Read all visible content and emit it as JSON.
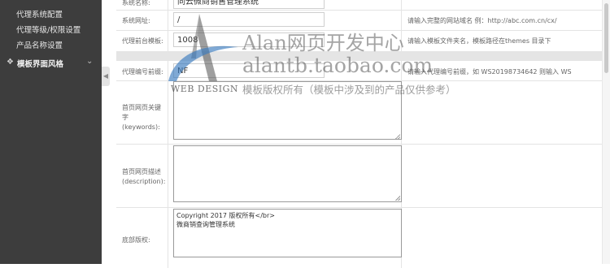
{
  "sidebar": {
    "items": [
      {
        "label": "代理系统配置"
      },
      {
        "label": "代理等级/权限设置"
      },
      {
        "label": "产品名称设置"
      }
    ],
    "section": {
      "label": "模板界面风格",
      "icon": "settings-gear-icon"
    }
  },
  "form": {
    "rows": [
      {
        "label": "系统名称:",
        "value": "同云微商销售管理系统",
        "hint": ""
      },
      {
        "label": "系统网址:",
        "value": "/",
        "hint": "请输入完整的网站域名 例：http://abc.com.cn/cx/"
      },
      {
        "label": "代理前台模板:",
        "value": "1008",
        "hint": "请输入模板文件夹名，模板路径在themes 目录下"
      },
      {
        "label": "代理编号前缀:",
        "value": "NF",
        "hint": "请输入代理编号前缀，如 WS20198734642 则输入 WS"
      }
    ],
    "keywords": {
      "label_line1": "首页网页关键字",
      "label_line2": "(keywords):",
      "value": ""
    },
    "description": {
      "label_line1": "首页网页描述",
      "label_line2": "(description):",
      "value": ""
    },
    "copyright": {
      "label": "底部版权:",
      "line1": "Copyright  2017 版权所有</br>",
      "line2": "微商销查询管理系统"
    }
  },
  "watermark": {
    "line1": "Alan网页开发中心",
    "line2": "alantb.taobao.com",
    "line3": "模板版权所有（模板中涉及到的产品仅供参考）",
    "brand": "WEB DESIGN"
  },
  "colors": {
    "sidebar_bg": "#3d3d3d",
    "accent_blue": "#3a7bbf"
  }
}
